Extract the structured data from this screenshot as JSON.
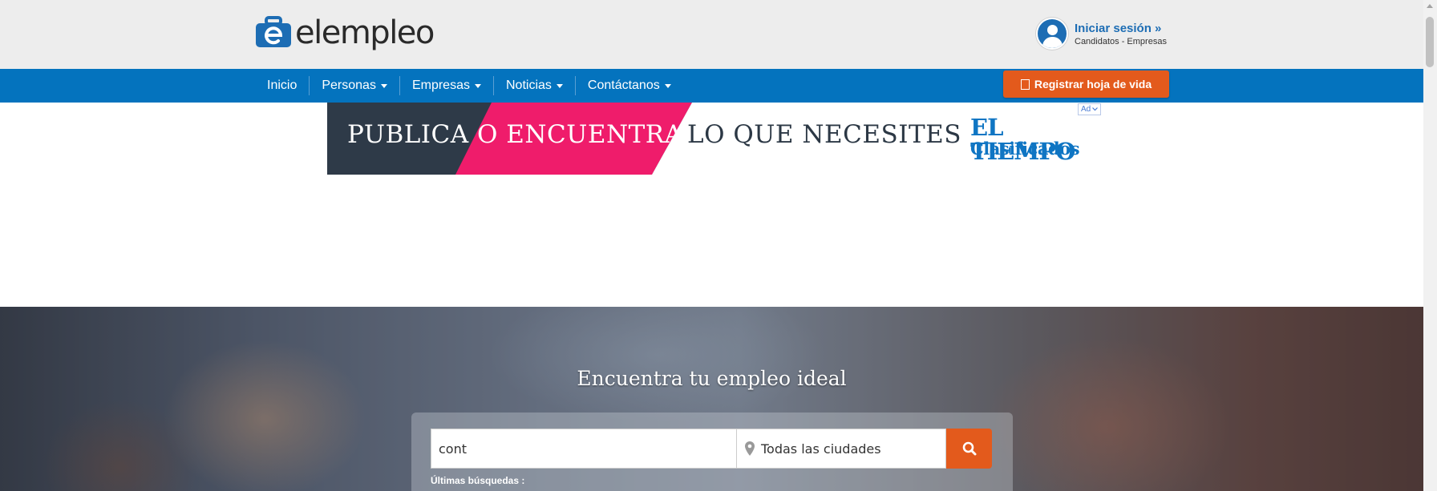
{
  "header": {
    "logo_text": "elempleo",
    "login": {
      "label": "Iniciar sesión »",
      "sub": "Candidatos - Empresas"
    }
  },
  "nav": {
    "items": [
      {
        "label": "Inicio",
        "has_dropdown": false
      },
      {
        "label": "Personas",
        "has_dropdown": true
      },
      {
        "label": "Empresas",
        "has_dropdown": true
      },
      {
        "label": "Noticias",
        "has_dropdown": true
      },
      {
        "label": "Contáctanos",
        "has_dropdown": true
      }
    ],
    "register_label": "Registrar hoja de vida"
  },
  "ad": {
    "text_primary": "PUBLICA O ENCUENTRA",
    "text_secondary": "LO QUE NECESITES",
    "brand_line_1": "EL TIEMPO",
    "brand_line_2": "Clasificados",
    "badge": "Ad"
  },
  "hero": {
    "title": "Encuentra tu empleo ideal",
    "search_value": "cont",
    "city_value": "Todas las ciudades",
    "last_searches_label": "Últimas búsquedas :"
  },
  "colors": {
    "nav_blue": "#0473be",
    "accent_orange": "#e35a1c",
    "header_bg": "#ededed",
    "ad_dark": "#2e3a48",
    "ad_pink": "#ef1c6b",
    "brand_blue": "#0f75c3"
  }
}
